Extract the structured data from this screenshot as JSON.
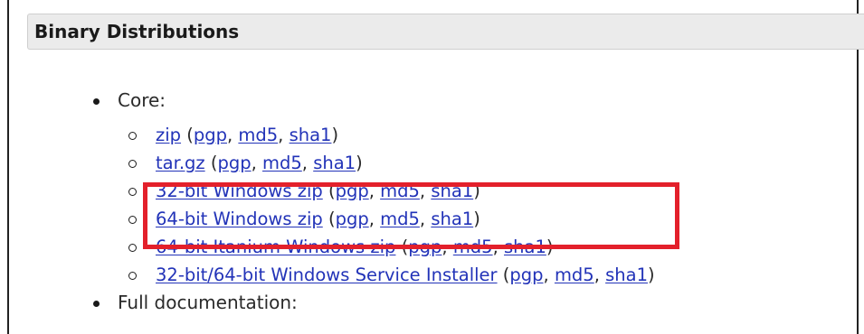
{
  "section": {
    "title": "Binary Distributions"
  },
  "lists": {
    "core_label": "Core:",
    "full_doc_label": "Full documentation:",
    "core_items": [
      {
        "main": "zip",
        "pgp": "pgp",
        "md5": "md5",
        "sha1": "sha1"
      },
      {
        "main": "tar.gz",
        "pgp": "pgp",
        "md5": "md5",
        "sha1": "sha1"
      },
      {
        "main": "32-bit Windows zip",
        "pgp": "pgp",
        "md5": "md5",
        "sha1": "sha1"
      },
      {
        "main": "64-bit Windows zip",
        "pgp": "pgp",
        "md5": "md5",
        "sha1": "sha1"
      },
      {
        "main": "64-bit Itanium Windows zip",
        "pgp": "pgp",
        "md5": "md5",
        "sha1": "sha1"
      },
      {
        "main": "32-bit/64-bit Windows Service Installer",
        "pgp": "pgp",
        "md5": "md5",
        "sha1": "sha1"
      }
    ]
  },
  "punctuation": {
    "open": " (",
    "sep": ", ",
    "close": ")"
  },
  "colors": {
    "link": "#2233b8",
    "highlight": "#e3202b",
    "header_bg": "#ebebeb"
  }
}
